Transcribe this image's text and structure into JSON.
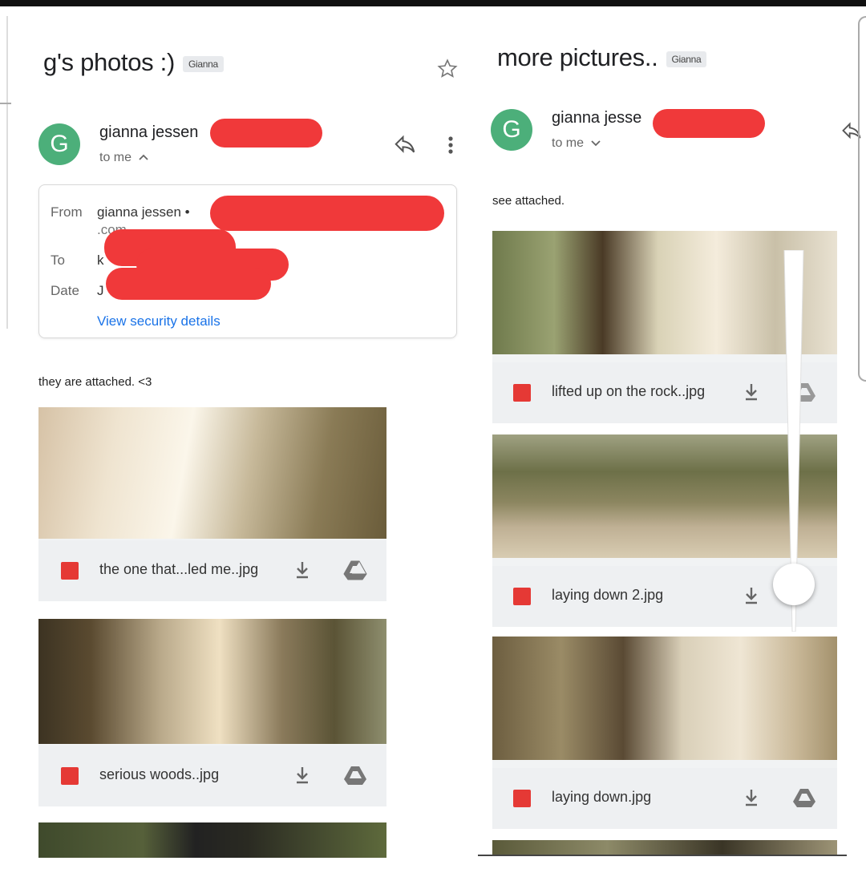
{
  "left_email": {
    "subject": "g's photos :)",
    "label_chip": "Gianna",
    "avatar_letter": "G",
    "sender_name": "gianna jessen",
    "recipient_summary": "to me",
    "details": {
      "from_label": "From",
      "from_value": "gianna jessen •",
      "from_domain_tail": ".com",
      "to_label": "To",
      "to_value": "k",
      "date_label": "Date",
      "date_value": "J",
      "security_link": "View security details"
    },
    "body_text": "they are attached. <3",
    "attachments": [
      {
        "filename": "the one that...led me..jpg"
      },
      {
        "filename": "serious woods..jpg"
      }
    ]
  },
  "right_email": {
    "subject": "more pictures..",
    "label_chip": "Gianna",
    "avatar_letter": "G",
    "sender_name": "gianna jesse",
    "recipient_summary": "to me",
    "body_text": "see attached.",
    "attachments": [
      {
        "filename": "lifted up on the rock..jpg"
      },
      {
        "filename": "laying down 2.jpg"
      },
      {
        "filename": "laying down.jpg"
      }
    ]
  },
  "colors": {
    "avatar": "#4caf7a",
    "redaction": "#f0393a",
    "link": "#1a73e8",
    "image_icon": "#e53935"
  },
  "icons": [
    "star-icon",
    "reply-icon",
    "more-vert-icon",
    "chevron-up-icon",
    "chevron-down-icon",
    "image-file-icon",
    "download-icon",
    "drive-icon"
  ]
}
